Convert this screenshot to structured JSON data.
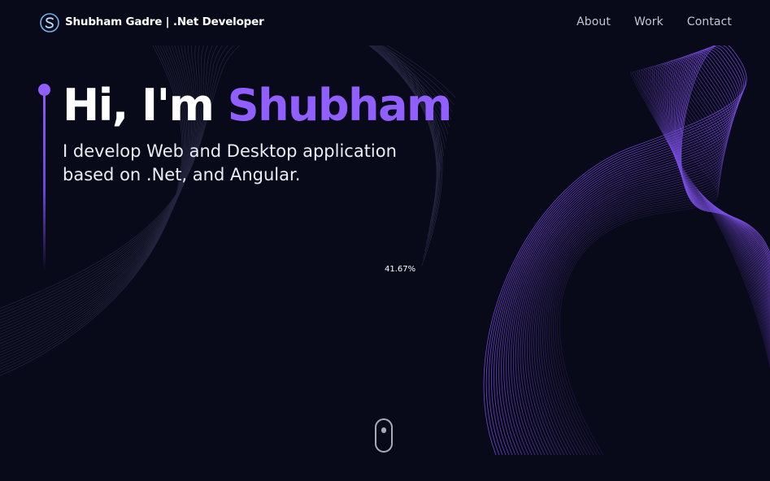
{
  "header": {
    "logo_icon": "s-logo-icon",
    "brand": "Shubham Gadre | .Net Developer",
    "nav": [
      {
        "label": "About"
      },
      {
        "label": "Work"
      },
      {
        "label": "Contact"
      }
    ]
  },
  "hero": {
    "greeting": "Hi, I'm ",
    "name": "Shubham",
    "subtitle": "I develop Web and Desktop application based on .Net, and Angular."
  },
  "loader": {
    "progress_text": "41.67%"
  },
  "scroll_indicator": {
    "icon": "mouse-scroll-icon"
  },
  "colors": {
    "background": "#090a19",
    "accent": "#915eff",
    "text": "#ffffff",
    "nav_text": "#c3c5d2"
  }
}
